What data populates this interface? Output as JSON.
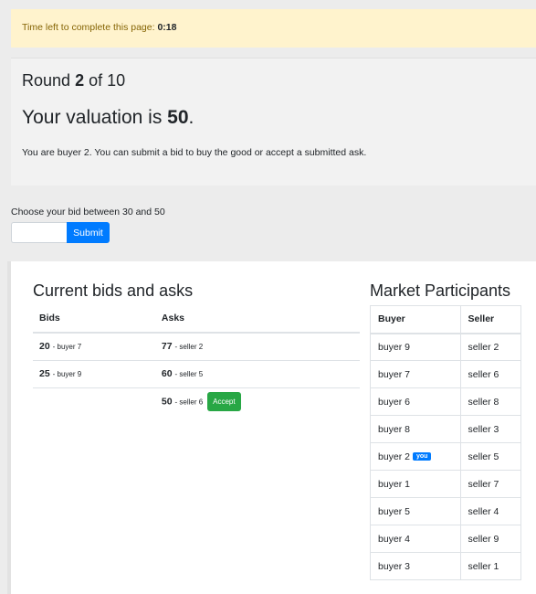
{
  "timer": {
    "label": "Time left to complete this page:",
    "value": "0:18"
  },
  "round": {
    "prefix": "Round",
    "current": "2",
    "of": "of 10"
  },
  "valuation": {
    "prefix": "Your valuation is",
    "value": "50",
    "suffix": "."
  },
  "role_text": "You are buyer 2. You can submit a bid to buy the good or accept a submitted ask.",
  "bid_form": {
    "label": "Choose your bid between 30 and 50",
    "input_value": "",
    "submit_label": "Submit"
  },
  "market": {
    "title": "Current bids and asks",
    "headers": {
      "bids": "Bids",
      "asks": "Asks"
    },
    "rows": [
      {
        "bid_value": "20",
        "bid_who": "- buyer 7",
        "ask_value": "77",
        "ask_who": "- seller 2"
      },
      {
        "bid_value": "25",
        "bid_who": "- buyer 9",
        "ask_value": "60",
        "ask_who": "- seller 5"
      },
      {
        "bid_value": "",
        "bid_who": "",
        "ask_value": "50",
        "ask_who": "- seller 6",
        "accept_label": "Accept"
      }
    ]
  },
  "participants": {
    "title": "Market Participants",
    "headers": {
      "buyer": "Buyer",
      "seller": "Seller"
    },
    "you_badge": "you",
    "rows": [
      {
        "buyer": "buyer 9",
        "seller": "seller 2"
      },
      {
        "buyer": "buyer 7",
        "seller": "seller 6"
      },
      {
        "buyer": "buyer 6",
        "seller": "seller 8"
      },
      {
        "buyer": "buyer 8",
        "seller": "seller 3"
      },
      {
        "buyer": "buyer 2",
        "seller": "seller 5"
      },
      {
        "buyer": "buyer 1",
        "seller": "seller 7"
      },
      {
        "buyer": "buyer 5",
        "seller": "seller 4"
      },
      {
        "buyer": "buyer 4",
        "seller": "seller 9"
      },
      {
        "buyer": "buyer 3",
        "seller": "seller 1"
      }
    ]
  },
  "colors": {
    "primary": "#007bff",
    "success": "#28a745",
    "warning_bg": "#fff3cd"
  }
}
